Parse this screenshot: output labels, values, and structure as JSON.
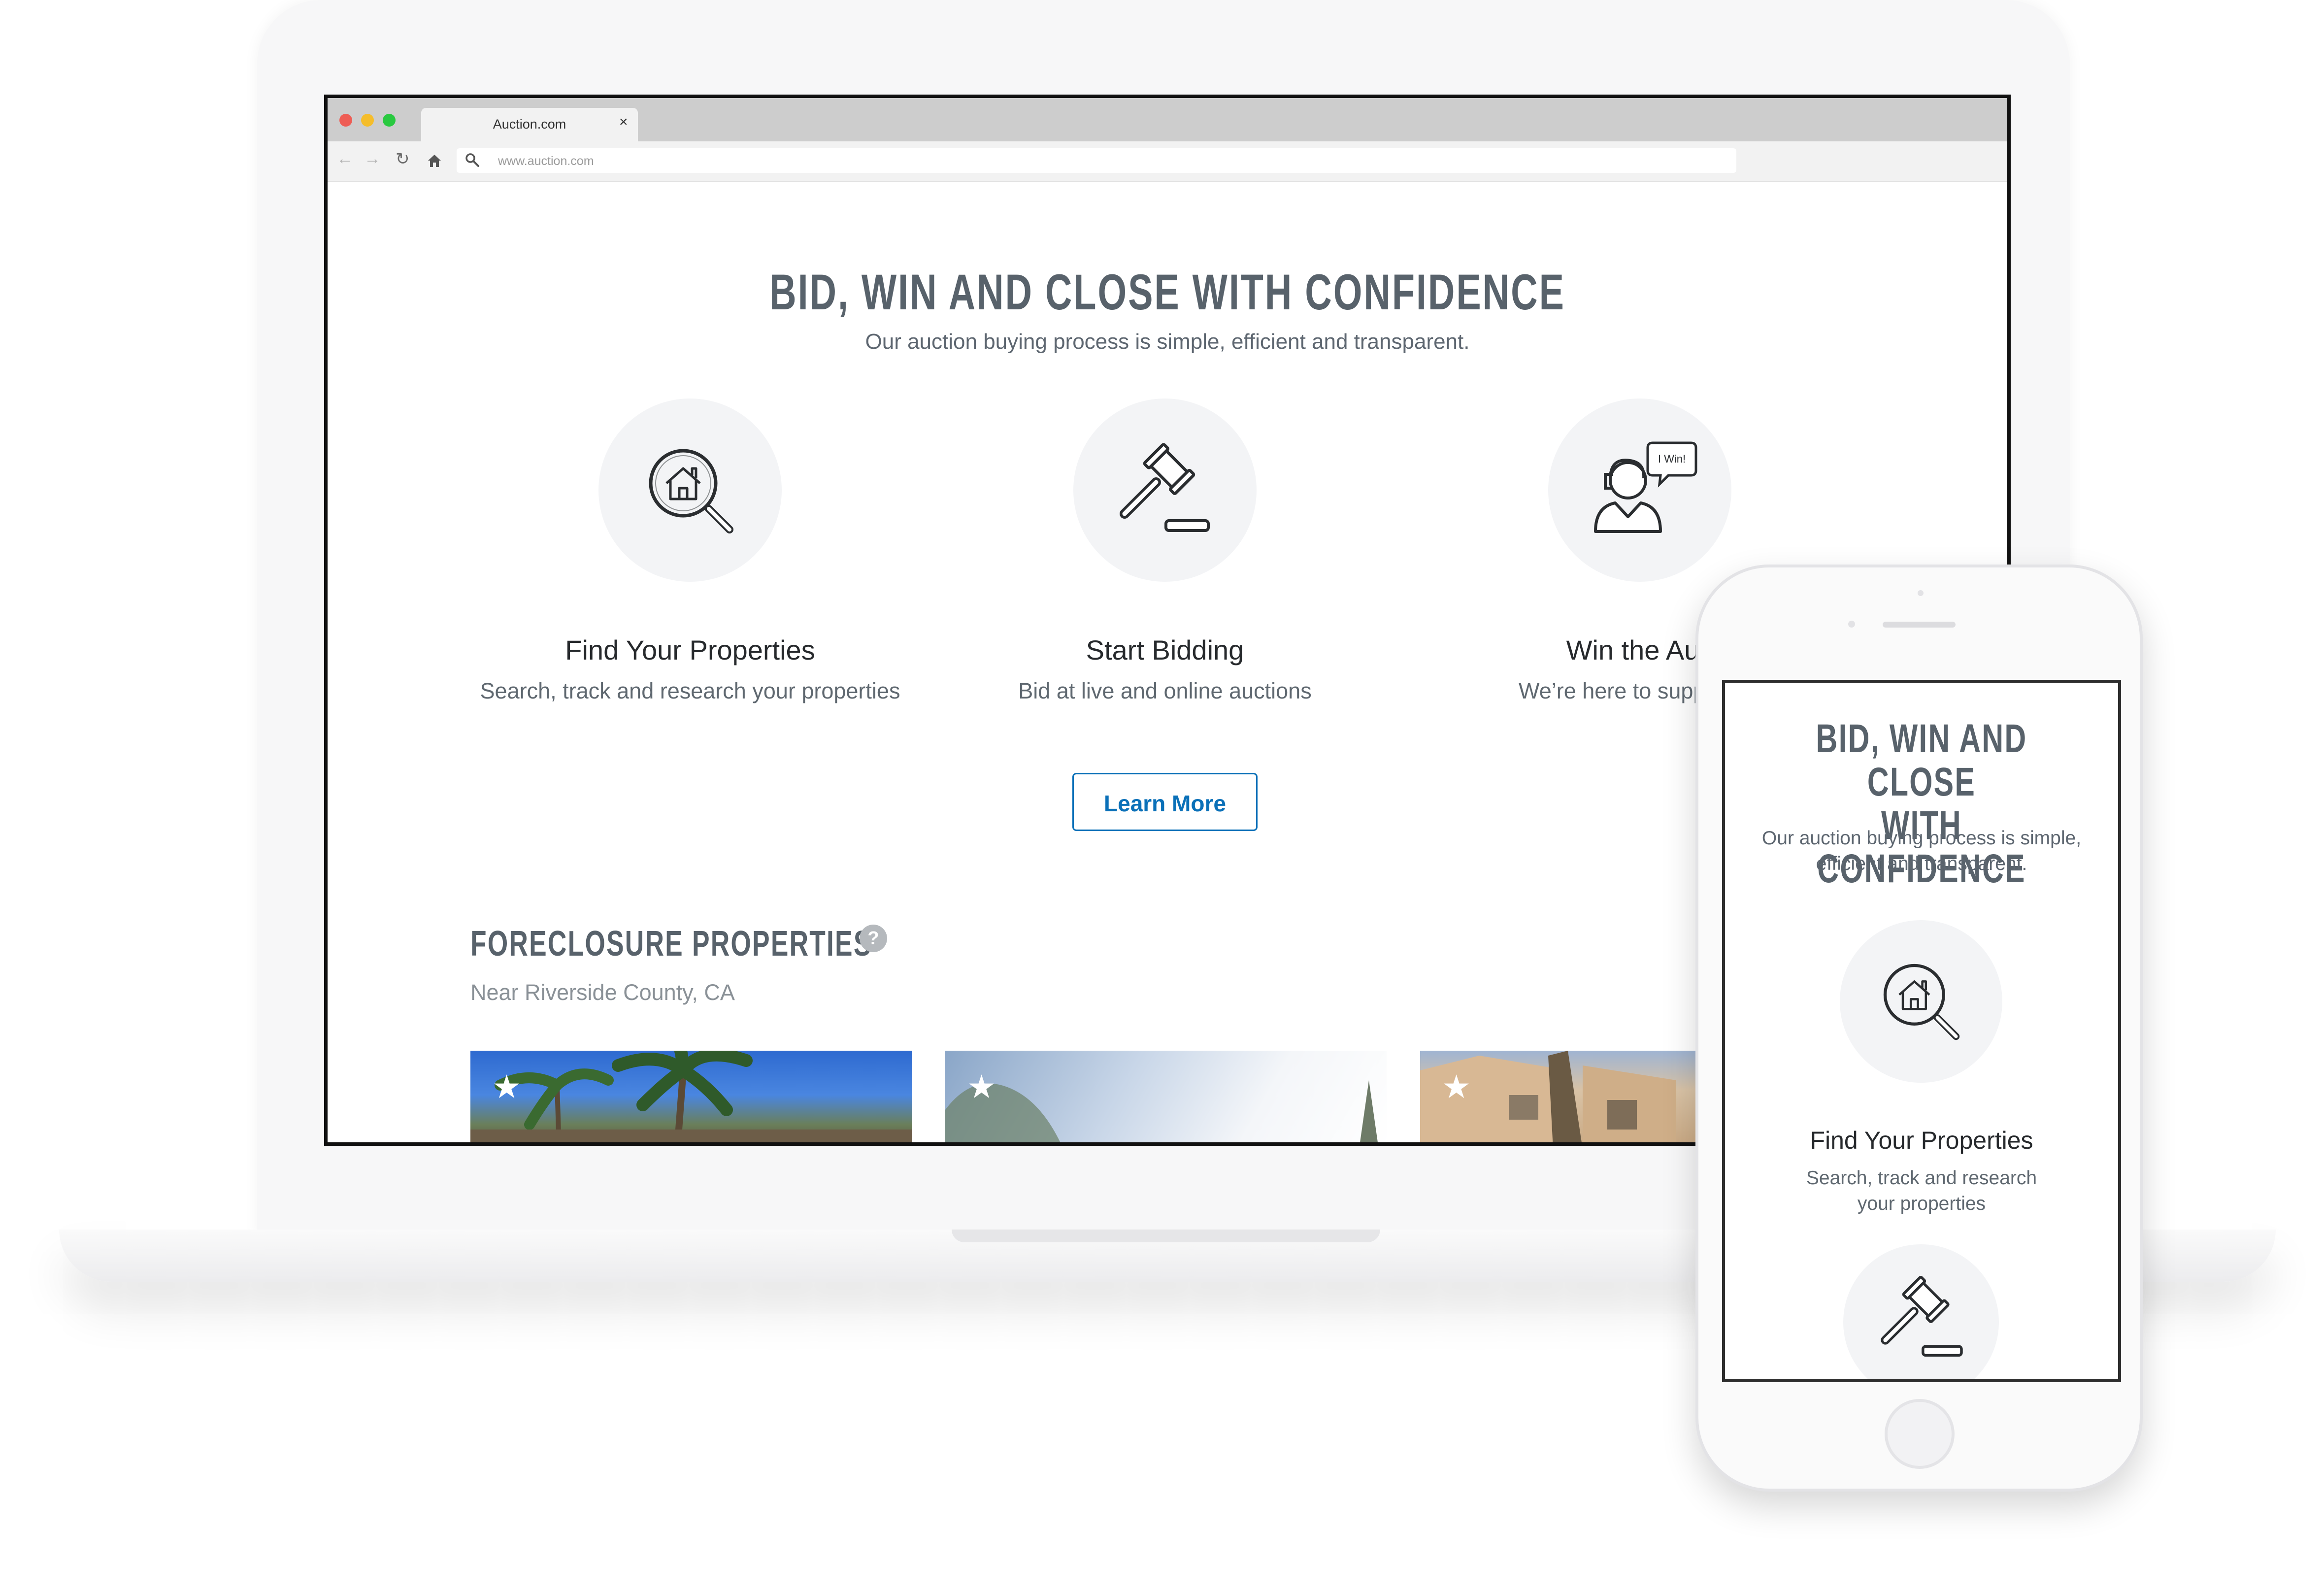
{
  "browser": {
    "tab_title": "Auction.com",
    "tab_close": "×",
    "url": "www.auction.com",
    "traffic_lights": {
      "close": "#ee5d55",
      "minimize": "#f5bd2b",
      "maximize": "#29c940"
    }
  },
  "hero": {
    "title": "BID, WIN AND CLOSE WITH CONFIDENCE",
    "subtitle": "Our auction buying process is simple, efficient and transparent."
  },
  "features": [
    {
      "icon": "house-search-icon",
      "title": "Find Your Properties",
      "description": "Search, track and research your properties"
    },
    {
      "icon": "gavel-icon",
      "title": "Start Bidding",
      "description": "Bid at live and online auctions"
    },
    {
      "icon": "winner-icon",
      "title": "Win the Auc",
      "description": "We’re here to support yo",
      "bubble_text": "I Win!"
    }
  ],
  "cta": {
    "learn_more": "Learn More"
  },
  "listings": {
    "title": "FORECLOSURE PROPERTIES",
    "help": "?",
    "location": "Near Riverside County, CA"
  },
  "mobile": {
    "title_line1": "BID, WIN AND CLOSE",
    "title_line2": "WITH CONFIDENCE",
    "subtitle": "Our auction buying process is simple, efficient and transparent.",
    "feature_title": "Find Your Properties",
    "feature_description": "Search, track and research your properties"
  },
  "colors": {
    "accent": "#0a70b8",
    "heading": "#58626b",
    "text": "#5f6870",
    "circle_bg": "#f3f4f6"
  }
}
